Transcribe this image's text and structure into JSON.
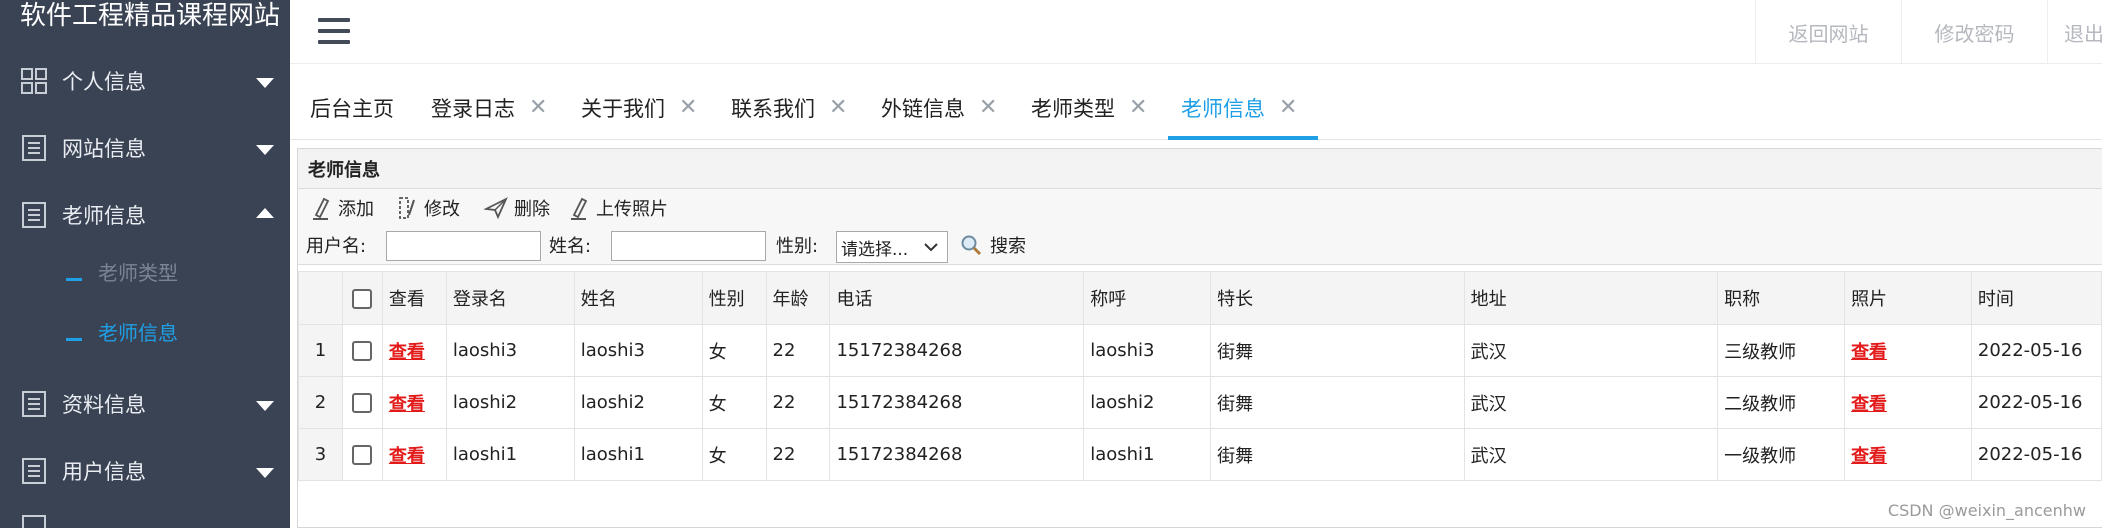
{
  "sidebar": {
    "site_title": "软件工程精品课程网站",
    "menus": [
      {
        "label": "个人信息",
        "icon": "grid-icon",
        "expanded": false
      },
      {
        "label": "网站信息",
        "icon": "document-icon",
        "expanded": false
      },
      {
        "label": "老师信息",
        "icon": "document-icon",
        "expanded": true
      },
      {
        "label": "资料信息",
        "icon": "document-icon",
        "expanded": false
      },
      {
        "label": "用户信息",
        "icon": "document-icon",
        "expanded": false
      }
    ],
    "submenu": [
      {
        "label": "老师类型",
        "active": false
      },
      {
        "label": "老师信息",
        "active": true
      }
    ]
  },
  "topbar": {
    "links": [
      "返回网站",
      "修改密码",
      "退出"
    ]
  },
  "tabs": [
    {
      "label": "后台主页",
      "closable": false,
      "active": false
    },
    {
      "label": "登录日志",
      "closable": true,
      "active": false
    },
    {
      "label": "关于我们",
      "closable": true,
      "active": false
    },
    {
      "label": "联系我们",
      "closable": true,
      "active": false
    },
    {
      "label": "外链信息",
      "closable": true,
      "active": false
    },
    {
      "label": "老师类型",
      "closable": true,
      "active": false
    },
    {
      "label": "老师信息",
      "closable": true,
      "active": true
    }
  ],
  "tab_close_glyph": "✕",
  "panel": {
    "title": "老师信息",
    "toolbar": {
      "add": "添加",
      "edit": "修改",
      "delete": "删除",
      "upload_photo": "上传照片"
    },
    "search": {
      "username_label": "用户名:",
      "username_value": "",
      "name_label": "姓名:",
      "name_value": "",
      "gender_label": "性别:",
      "gender_selected": "请选择...",
      "search_button": "搜索"
    },
    "table": {
      "columns": [
        "查看",
        "登录名",
        "姓名",
        "性别",
        "年龄",
        "电话",
        "称呼",
        "特长",
        "地址",
        "职称",
        "照片",
        "时间"
      ],
      "rows": [
        {
          "num": "1",
          "view": "查看",
          "login": "laoshi3",
          "name": "laoshi3",
          "gender": "女",
          "age": "22",
          "phone": "15172384268",
          "title_name": "laoshi3",
          "skill": "街舞",
          "address": "武汉",
          "rank": "三级教师",
          "photo": "查看",
          "time": "2022-05-16"
        },
        {
          "num": "2",
          "view": "查看",
          "login": "laoshi2",
          "name": "laoshi2",
          "gender": "女",
          "age": "22",
          "phone": "15172384268",
          "title_name": "laoshi2",
          "skill": "街舞",
          "address": "武汉",
          "rank": "二级教师",
          "photo": "查看",
          "time": "2022-05-16"
        },
        {
          "num": "3",
          "view": "查看",
          "login": "laoshi1",
          "name": "laoshi1",
          "gender": "女",
          "age": "22",
          "phone": "15172384268",
          "title_name": "laoshi1",
          "skill": "街舞",
          "address": "武汉",
          "rank": "一级教师",
          "photo": "查看",
          "time": "2022-05-16"
        }
      ]
    }
  },
  "watermark": "CSDN @weixin_ancenhw",
  "colors": {
    "sidebar_bg": "#3a4354",
    "accent": "#1e9fe6",
    "link_red": "#e21a1a"
  }
}
